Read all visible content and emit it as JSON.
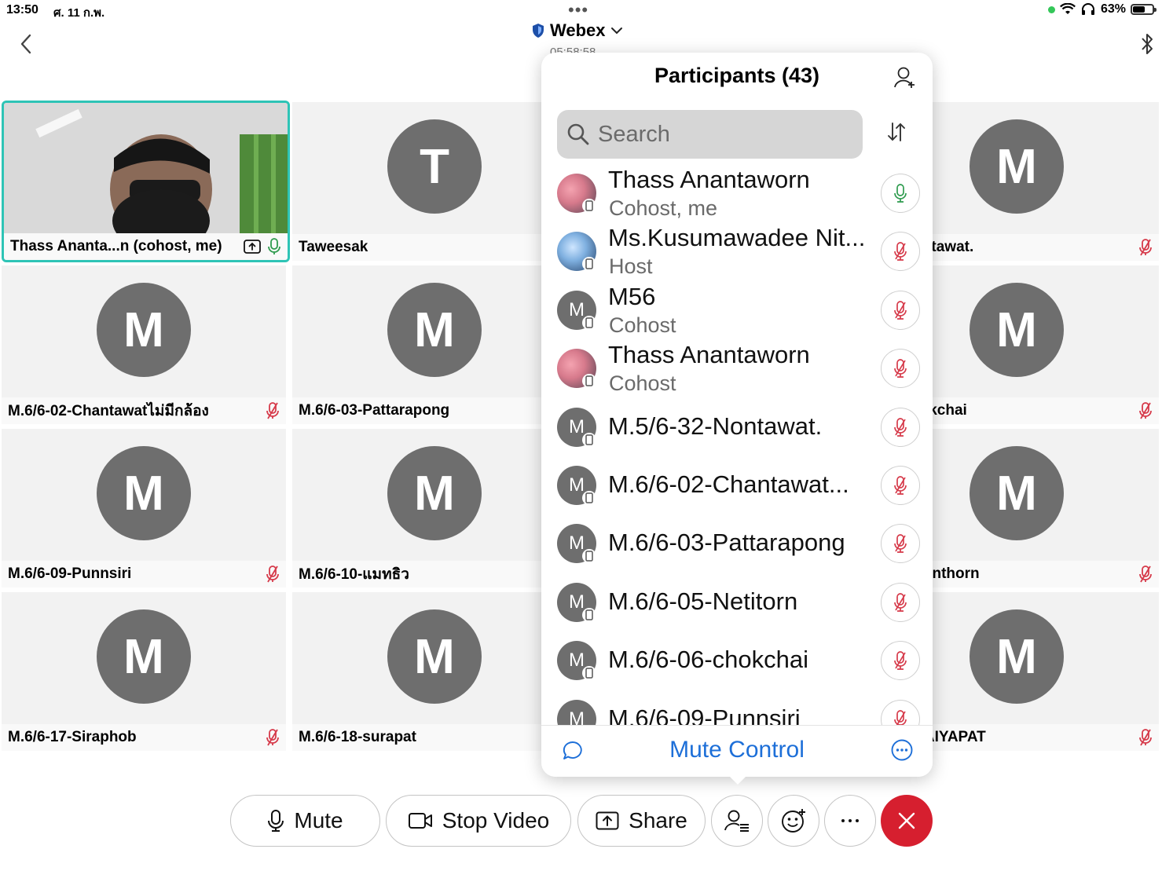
{
  "status_bar": {
    "time": "13:50",
    "date": "ศ. 11 ก.พ.",
    "battery": "63%",
    "battery_level": 0.63
  },
  "header": {
    "title": "Webex",
    "timer": "05:58:58"
  },
  "grid": {
    "self_tile": {
      "name": "Thass Ananta...n (cohost, me)"
    },
    "tiles": [
      {
        "initial": "T",
        "name": "Taweesak"
      },
      {
        "initial": "M",
        "name": "32-Nontawat."
      },
      {
        "initial": "M",
        "name": "M.6/6-02-Chantawatไม่มีกล้อง"
      },
      {
        "initial": "M",
        "name": "M.6/6-03-Pattarapong"
      },
      {
        "initial": "M",
        "name": "06-chokchai"
      },
      {
        "initial": "M",
        "name": "M.6/6-09-Punnsiri"
      },
      {
        "initial": "M",
        "name": "M.6/6-10-แมทธิว"
      },
      {
        "initial": "M",
        "name": "16-warinthorn"
      },
      {
        "initial": "M",
        "name": "M.6/6-17-Siraphob"
      },
      {
        "initial": "M",
        "name": "M.6/6-18-surapat"
      },
      {
        "initial": "M",
        "name": "21-CHAIYAPAT"
      }
    ]
  },
  "participants_panel": {
    "title": "Participants (43)",
    "search_placeholder": "Search",
    "participants": [
      {
        "name": "Thass Anantaworn",
        "role": "Cohost, me",
        "initial": "",
        "mic": "unmuted"
      },
      {
        "name": "Ms.Kusumawadee Nit...",
        "role": "Host",
        "initial": "",
        "mic": "muted"
      },
      {
        "name": "M56",
        "role": "Cohost",
        "initial": "M",
        "mic": "muted"
      },
      {
        "name": "Thass Anantaworn",
        "role": "Cohost",
        "initial": "",
        "mic": "muted"
      },
      {
        "name": "M.5/6-32-Nontawat.",
        "role": "",
        "initial": "M",
        "mic": "muted"
      },
      {
        "name": "M.6/6-02-Chantawat...",
        "role": "",
        "initial": "M",
        "mic": "muted"
      },
      {
        "name": "M.6/6-03-Pattarapong",
        "role": "",
        "initial": "M",
        "mic": "muted"
      },
      {
        "name": "M.6/6-05-Netitorn",
        "role": "",
        "initial": "M",
        "mic": "muted"
      },
      {
        "name": "M.6/6-06-chokchai",
        "role": "",
        "initial": "M",
        "mic": "muted"
      },
      {
        "name": "M.6/6-09-Punnsiri",
        "role": "",
        "initial": "M",
        "mic": "muted"
      }
    ],
    "footer_action": "Mute Control"
  },
  "toolbar": {
    "mute_label": "Mute",
    "stop_video_label": "Stop Video",
    "share_label": "Share"
  },
  "colors": {
    "accent_blue": "#1d6fd8",
    "end_red": "#d61f2f",
    "active_border": "#2ec4b6",
    "mic_unmuted": "#2e9b4e",
    "mic_muted": "#d63a4a"
  }
}
